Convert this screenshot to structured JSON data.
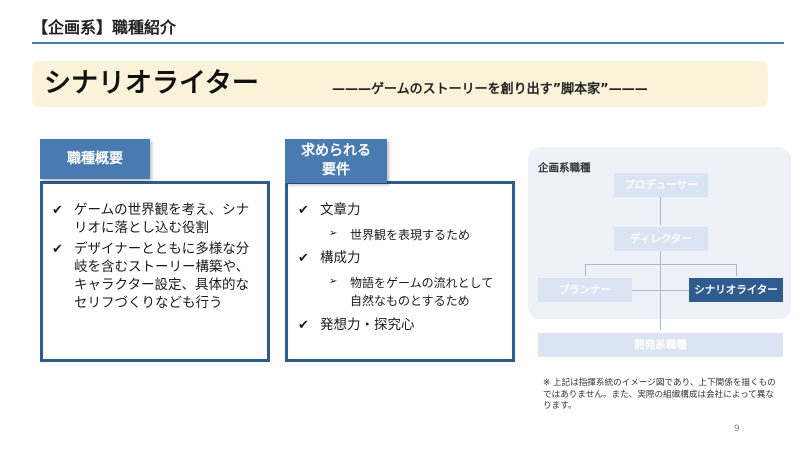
{
  "header": {
    "section_title": "【企画系】職種紹介"
  },
  "banner": {
    "title": "シナリオライター",
    "subtitle": "———ゲームのストーリーを創り出す”脚本家”———"
  },
  "overview": {
    "heading": "職種概要",
    "items": [
      "ゲームの世界観を考え、シナリオに落とし込む役割",
      "デザイナーとともに多様な分岐を含むストーリー構築や、キャラクター設定、具体的なセリフづくりなども行う"
    ]
  },
  "requirements": {
    "heading_line1": "求められる",
    "heading_line2": "要件",
    "items": [
      {
        "label": "文章力",
        "sub": "世界観を表現するため"
      },
      {
        "label": "構成力",
        "sub": "物語をゲームの流れとして自然なものとするため"
      },
      {
        "label": "発想力・探究心",
        "sub": ""
      }
    ]
  },
  "org_chart": {
    "label": "企画系職種",
    "producer": "プロデューサー",
    "director": "ディレクター",
    "planner": "プランナー",
    "scenario_writer": "シナリオライター",
    "dev": "開発系職種"
  },
  "footnote": "※ 上記は指揮系統のイメージ図であり、上下関係を描くものではありません。また、実際の組織構成は会社によって異なります。",
  "page_number": "9",
  "colors": {
    "accent": "#2e5c8f",
    "header_fill": "#4a7bb0",
    "banner": "#fbf3d9"
  },
  "icons": {
    "bullet": "check-icon",
    "sub_bullet": "arrow-right-icon"
  }
}
